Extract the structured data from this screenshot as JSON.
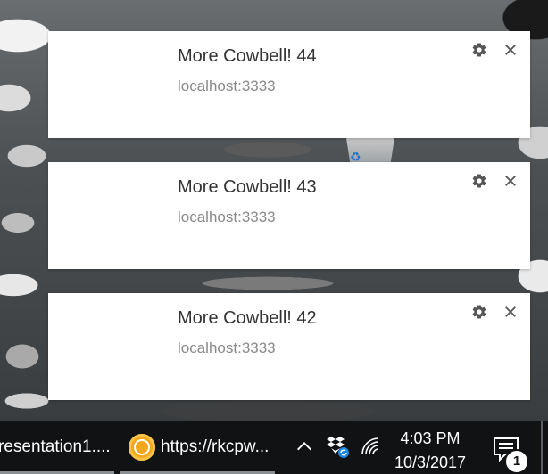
{
  "notifications": [
    {
      "title": "More Cowbell! 44",
      "origin": "localhost:3333"
    },
    {
      "title": "More Cowbell! 43",
      "origin": "localhost:3333"
    },
    {
      "title": "More Cowbell! 42",
      "origin": "localhost:3333"
    }
  ],
  "notification_icons": {
    "settings": "gear-icon",
    "close": "close-icon"
  },
  "taskbar": {
    "items": [
      {
        "label": "resentation1....",
        "icon": ""
      },
      {
        "label": "https://rkcpw...",
        "icon": "chrome-canary-icon"
      }
    ],
    "tray": {
      "icons": [
        "chevron-up-icon",
        "dropbox-icon",
        "wifi-icon"
      ],
      "time": "4:03 PM",
      "date": "10/3/2017",
      "action_center_badge": "1"
    }
  },
  "colors": {
    "taskbar": "#101214",
    "toast_bg": "#ffffff",
    "title_text": "#333333",
    "origin_text": "#8a8a8a",
    "accent_chrome": "#f2a81c"
  }
}
